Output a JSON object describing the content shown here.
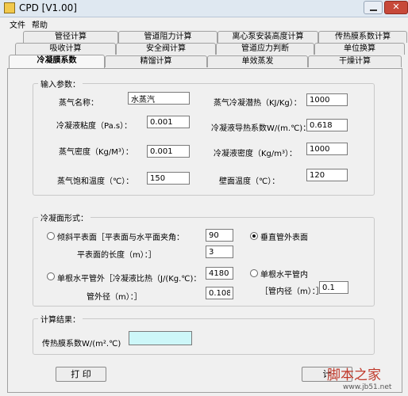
{
  "window": {
    "title": "CPD [V1.00]"
  },
  "menu": [
    {
      "label": "文件"
    },
    {
      "label": "帮助"
    }
  ],
  "tabs": {
    "row1": [
      "管径计算",
      "管道阻力计算",
      "离心泵安装高度计算",
      "传热膜系数计算"
    ],
    "row2": [
      "吸收计算",
      "安全阀计算",
      "管道应力判断",
      "单位换算"
    ],
    "row3": [
      "冷凝膜系数",
      "精馏计算",
      "单效蒸发",
      "干燥计算"
    ],
    "active": "冷凝膜系数"
  },
  "input_section": {
    "legend": "输入参数：",
    "vapor_name": {
      "label": "蒸气名称：",
      "value": "水蒸汽"
    },
    "latent_heat": {
      "label": "蒸气冷凝潜热（KJ/Kg）：",
      "value": "1000"
    },
    "viscosity": {
      "label": "冷凝液粘度（Pa.s）：",
      "value": "0.001"
    },
    "conductivity": {
      "label": "冷凝液导热系数W/(m.℃)：",
      "value": "0.618"
    },
    "vapor_density": {
      "label": "蒸气密度（Kg/M³）：",
      "value": "0.001"
    },
    "liquid_density": {
      "label": "冷凝液密度（Kg/m³）：",
      "value": "1000"
    },
    "saturation_temp": {
      "label": "蒸气饱和温度（℃）：",
      "value": "150"
    },
    "wall_temp": {
      "label": "壁面温度（℃）：",
      "value": "120"
    }
  },
  "surface_section": {
    "legend": "冷凝面形式：",
    "inclined": {
      "label": "倾斜平表面［平表面与水平面夹角：",
      "value": "90",
      "selected": false
    },
    "plate_length": {
      "label": "平表面的长度（m）：］",
      "value": "3"
    },
    "vertical": {
      "label": "垂直管外表面",
      "selected": true
    },
    "tube_outside": {
      "label": "单根水平管外［冷凝液比热（J/(Kg.℃)：",
      "value": "4180",
      "selected": false
    },
    "outer_diameter": {
      "label": "管外径（m）：］",
      "value": "0.108"
    },
    "tube_inside": {
      "label": "单根水平管内",
      "selected": false
    },
    "inner_diameter": {
      "label": "［管内径（m）：］",
      "value": "0.1"
    }
  },
  "result_section": {
    "legend": "计算结果：",
    "film_coefficient": {
      "label": "传热膜系数W/(m².℃)",
      "value": ""
    }
  },
  "buttons": {
    "print": "打  印",
    "calculate": "计"
  },
  "watermark": {
    "text": "脚本之家",
    "url": "www.jb51.net"
  }
}
